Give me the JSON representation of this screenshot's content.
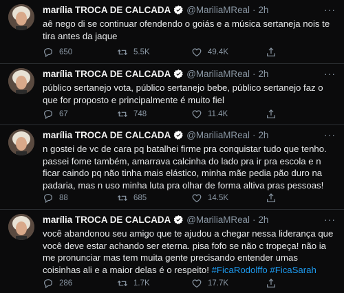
{
  "colors": {
    "background": "#0b0b0c",
    "text": "#e7e9ea",
    "muted": "#8b98a5",
    "link": "#1d9bf0",
    "verified": "#ffffff"
  },
  "tweets": [
    {
      "name": "marília TROCA DE CALCADA",
      "handle": "@MariliaMReal",
      "dot": "·",
      "time": "2h",
      "more": "···",
      "text": "aê nego di se continuar ofendendo o goiás e a música sertaneja nois te tira antes da jaque",
      "replies": "650",
      "retweets": "5.5K",
      "likes": "49.4K"
    },
    {
      "name": "marília TROCA DE CALCADA",
      "handle": "@MariliaMReal",
      "dot": "·",
      "time": "2h",
      "more": "···",
      "text": "público sertanejo vota, público sertanejo bebe, público sertanejo faz o que for proposto e principalmente é muito fiel",
      "replies": "67",
      "retweets": "748",
      "likes": "11.4K"
    },
    {
      "name": "marília TROCA DE CALCADA",
      "handle": "@MariliaMReal",
      "dot": "·",
      "time": "2h",
      "more": "···",
      "text": "n gostei de vc de cara pq batalhei firme pra conquistar tudo que tenho. passei fome também, amarrava calcinha do lado pra ir pra escola e n ficar caindo pq não tinha mais elástico, minha mãe pedia pão duro na padaria, mas n uso minha luta pra olhar de forma altiva pras pessoas!",
      "replies": "88",
      "retweets": "685",
      "likes": "14.5K"
    },
    {
      "name": "marília TROCA DE CALCADA",
      "handle": "@MariliaMReal",
      "dot": "·",
      "time": "2h",
      "more": "···",
      "text": "você abandonou seu amigo que te ajudou a chegar nessa liderança que você deve estar achando ser eterna. pisa fofo se não c tropeça! não ia me pronunciar mas tem muita gente precisando entender umas coisinhas ali e a maior delas é o respeito!",
      "hashtags": [
        "#FicaRodolffo",
        "#FicaSarah"
      ],
      "replies": "286",
      "retweets": "1.7K",
      "likes": "17.7K"
    }
  ]
}
